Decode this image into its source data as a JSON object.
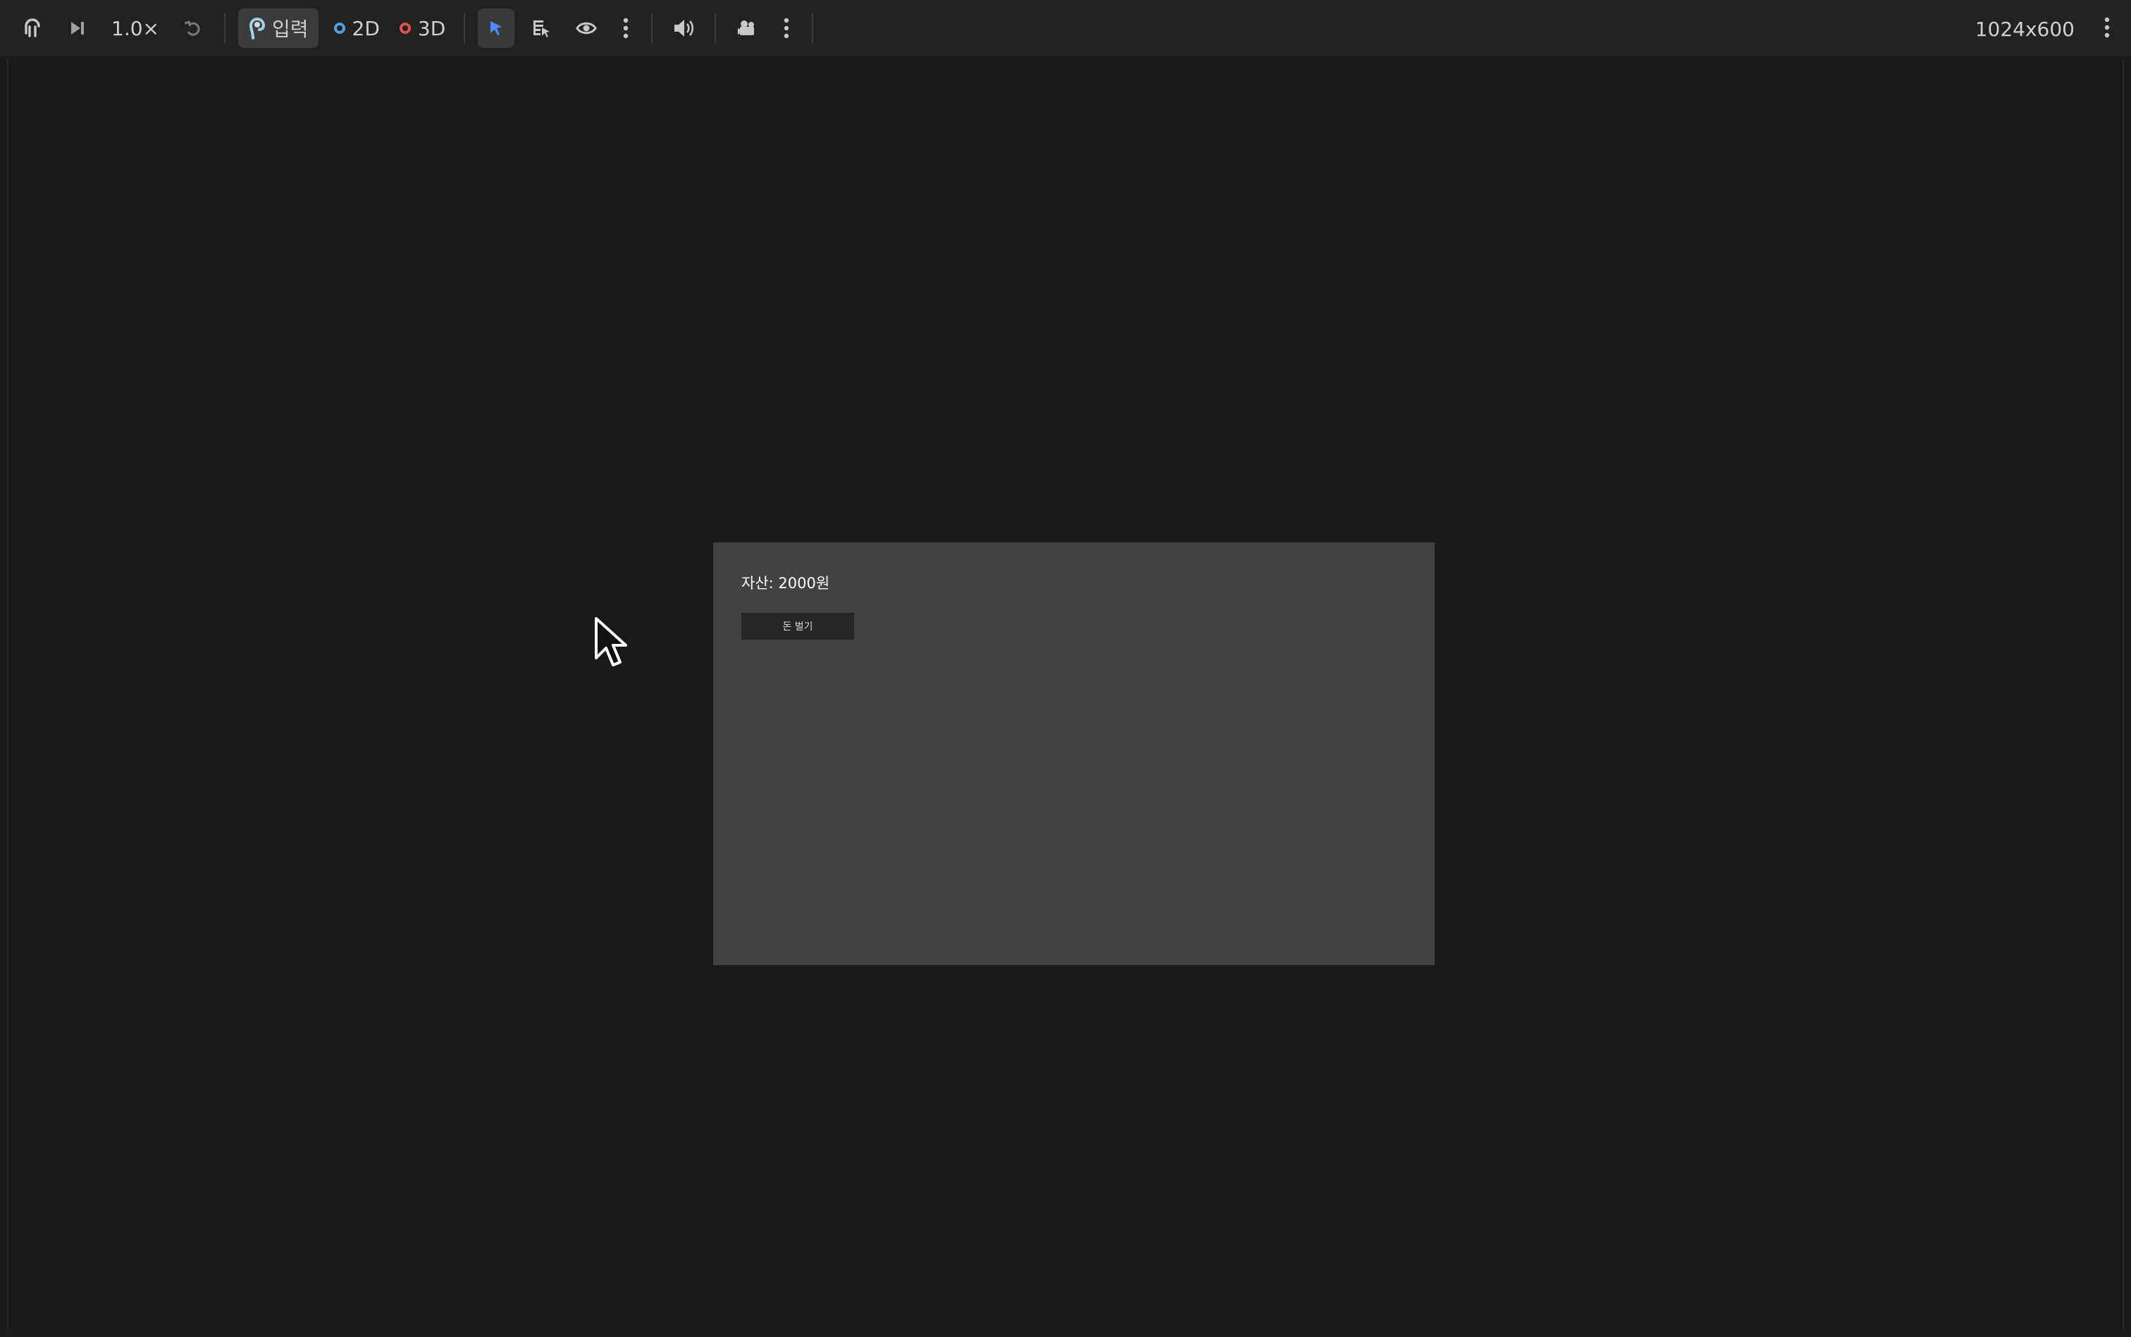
{
  "toolbar": {
    "speed_label": "1.0×",
    "input_label": "입력",
    "mode_2d_label": "2D",
    "mode_3d_label": "3D",
    "resolution": "1024x600",
    "colors": {
      "mode_2d": "#4aa3e8",
      "mode_3d": "#e05050",
      "select_active": "#4a8cff"
    },
    "icons": [
      "pause-icon",
      "step-forward-icon",
      "reset-icon",
      "input-icon",
      "select-icon",
      "list-select-icon",
      "eye-icon",
      "more-vert-icon",
      "speaker-icon",
      "camera-icon",
      "more-vert-icon",
      "more-vert-icon"
    ]
  },
  "game": {
    "asset_text": "자산: 2000원",
    "earn_button_label": "돈 벌기"
  }
}
